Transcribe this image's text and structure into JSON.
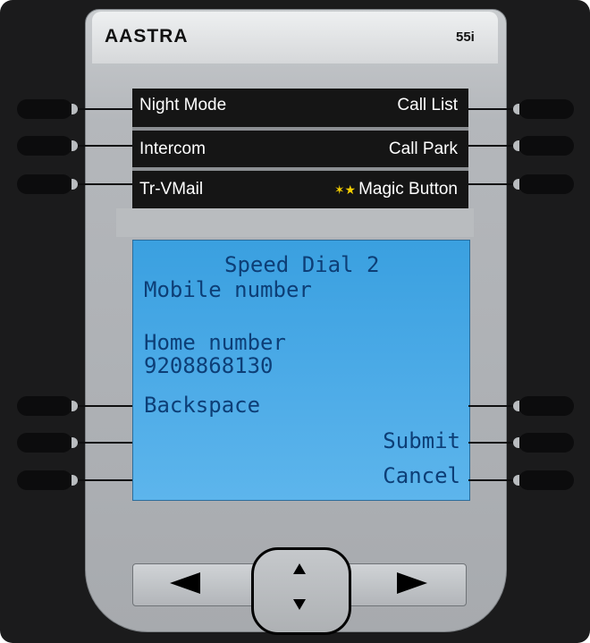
{
  "device": {
    "brand": "AASTRA",
    "model": "55i"
  },
  "softkeys": {
    "row1": {
      "left": "Night Mode",
      "right": "Call List"
    },
    "row2": {
      "left": "Intercom",
      "right": "Call Park"
    },
    "row3": {
      "left": "Tr-VMail",
      "right": "Magic Button",
      "right_icon": "stars-icon"
    }
  },
  "screen": {
    "title": "Speed Dial 2",
    "field1_label": "Mobile number",
    "field2_label": "Home number",
    "field2_value": "9208868130",
    "left_key": "Backspace",
    "right_key1": "Submit",
    "right_key2": "Cancel"
  },
  "nav": {
    "left_icon": "arrow-left-icon",
    "right_icon": "arrow-right-icon",
    "up_icon": "arrow-up-icon",
    "down_icon": "arrow-down-icon"
  },
  "colors": {
    "lcd_background": "#49a9e6",
    "lcd_text": "#0d3e76",
    "softkey_background": "#151515",
    "star_accent": "#f7d000"
  }
}
